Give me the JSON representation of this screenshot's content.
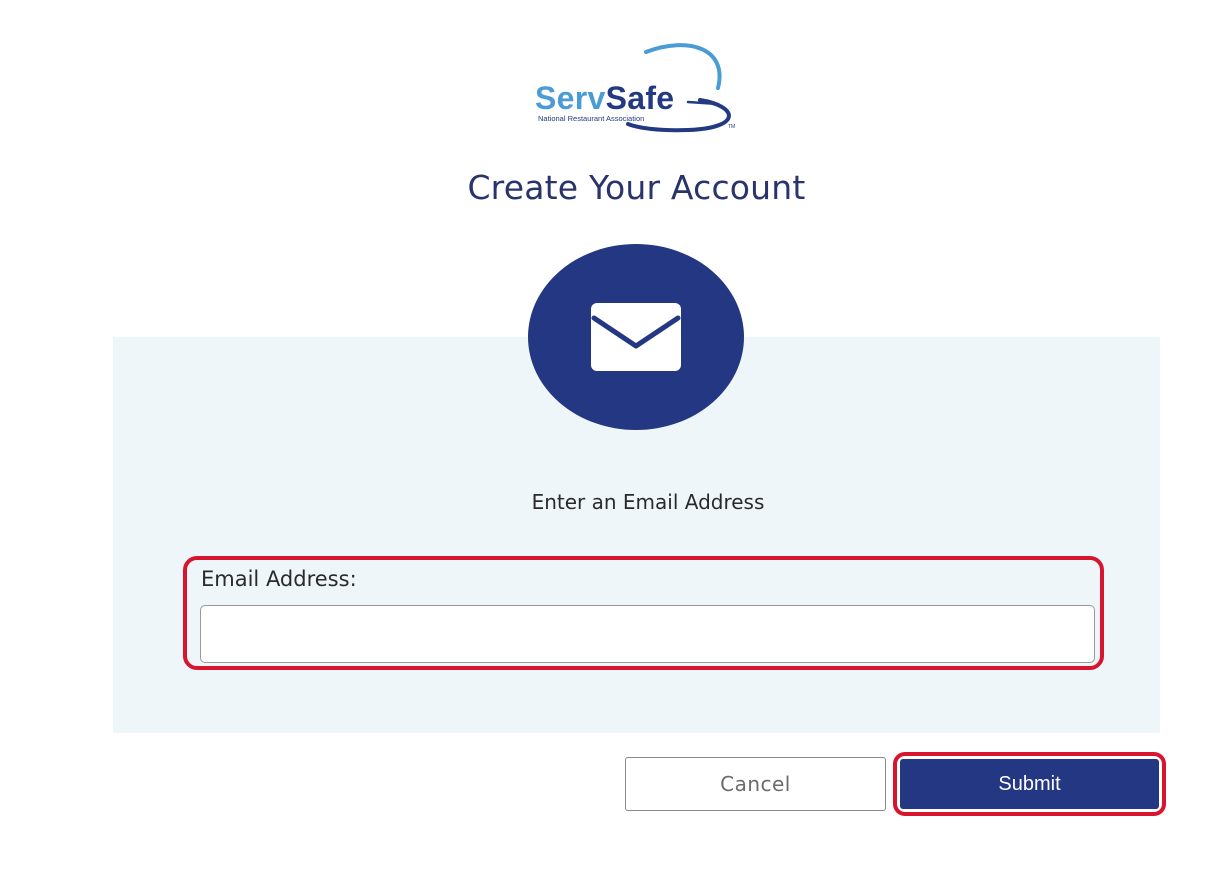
{
  "brand": {
    "name_part1": "Serv",
    "name_part2": "Safe",
    "subtitle": "National Restaurant Association",
    "trademark": "TM",
    "colors": {
      "light_blue": "#4a9bd6",
      "navy": "#233a82"
    }
  },
  "header": {
    "title": "Create Your Account"
  },
  "icon": {
    "name": "envelope-icon",
    "circle_color": "#243782"
  },
  "form": {
    "prompt": "Enter an Email Address",
    "email_label": "Email Address:",
    "email_value": "",
    "email_placeholder": ""
  },
  "actions": {
    "cancel_label": "Cancel",
    "submit_label": "Submit",
    "highlight_color": "#d7152f"
  }
}
